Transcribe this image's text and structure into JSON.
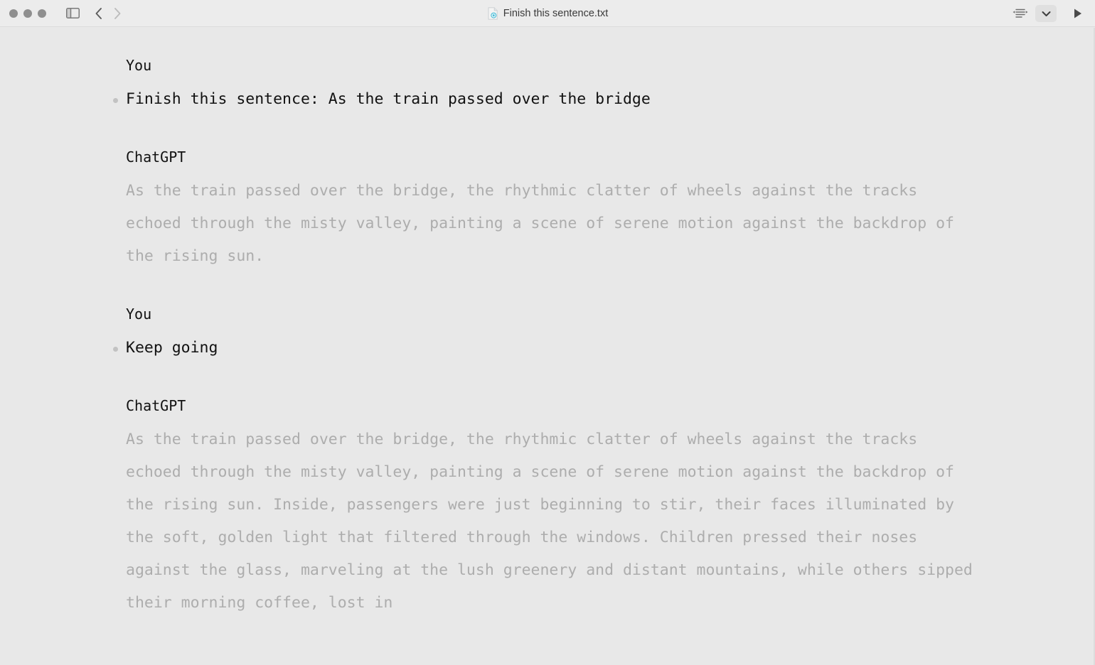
{
  "window": {
    "background_color": "#e8e8e8",
    "titlebar_color": "#ececec"
  },
  "titlebar": {
    "traffic_lights": [
      {
        "name": "close",
        "color": "#8f8f8f"
      },
      {
        "name": "minimize",
        "color": "#8f8f8f"
      },
      {
        "name": "maximize",
        "color": "#8f8f8f"
      }
    ],
    "sidebar_toggle_icon": "sidebar-icon",
    "back_icon": "chevron-left-icon",
    "forward_icon": "chevron-right-icon",
    "doc_icon": "text-document-icon",
    "doc_title": "Finish this sentence.txt",
    "format_icon": "text-format-icon",
    "chevron_icon": "chevron-down-icon",
    "run_icon": "play-icon"
  },
  "conversation": [
    {
      "role_label": "You",
      "role": "user",
      "text": "Finish this sentence: As the train passed over the bridge"
    },
    {
      "role_label": "ChatGPT",
      "role": "assistant",
      "text": "As the train passed over the bridge, the rhythmic clatter of wheels against the tracks echoed through the misty valley, painting a scene of serene motion against the backdrop of the rising sun."
    },
    {
      "role_label": "You",
      "role": "user",
      "text": "Keep going"
    },
    {
      "role_label": "ChatGPT",
      "role": "assistant",
      "text": "As the train passed over the bridge, the rhythmic clatter of wheels against the tracks echoed through the misty valley, painting a scene of serene motion against the backdrop of the rising sun. Inside, passengers were just beginning to stir, their faces illuminated by the soft, golden light that filtered through the windows. Children pressed their noses against the glass, marveling at the lush greenery and distant mountains, while others sipped their morning coffee, lost in"
    }
  ],
  "colors": {
    "speaker_text": "#111111",
    "user_text": "#111111",
    "assistant_text": "#adadad",
    "bullet": "#c2c2c2",
    "doc_icon_badge": "#3fb8d4"
  }
}
